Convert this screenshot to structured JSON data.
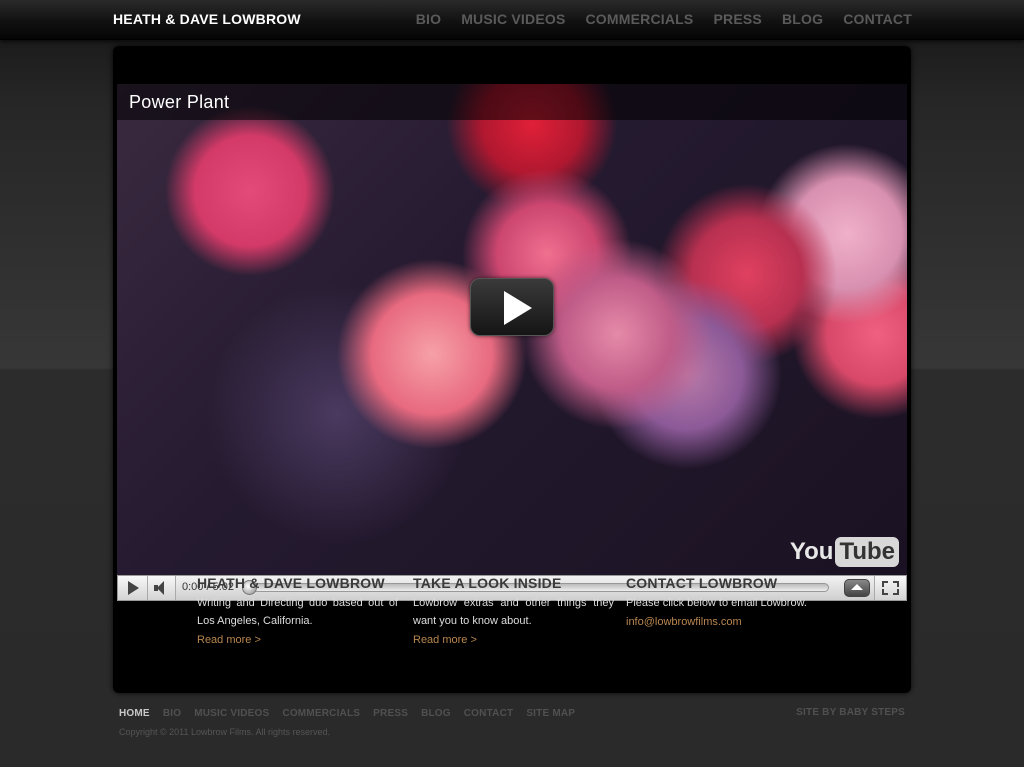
{
  "header": {
    "logo": "HEATH & DAVE LOWBROW",
    "nav": [
      "BIO",
      "MUSIC VIDEOS",
      "COMMERCIALS",
      "PRESS",
      "BLOG",
      "CONTACT"
    ]
  },
  "video": {
    "title": "Power Plant",
    "time": "0:00 / 5:02",
    "logo_you": "You",
    "logo_tube": "Tube",
    "progress": 0.0
  },
  "columns": [
    {
      "heading": "HEATH & DAVE LOWBROW",
      "text": "Writing and Directing duo based out of Los Angeles, California.",
      "link": "Read more >"
    },
    {
      "heading": "TAKE A LOOK INSIDE",
      "text": "Lowbrow extras and other things they want you to know about.",
      "link": "Read more >"
    },
    {
      "heading": "CONTACT LOWBROW",
      "text": "Please click below to email Lowbrow.",
      "link": "info@lowbrowfilms.com"
    }
  ],
  "footer": {
    "nav": [
      "HOME",
      "BIO",
      "MUSIC VIDEOS",
      "COMMERCIALS",
      "PRESS",
      "BLOG",
      "CONTACT",
      "SITE MAP"
    ],
    "site_by": "SITE BY BABY STEPS",
    "copyright": "Copyright © 2011 Lowbrow Films. All rights reserved."
  },
  "colors": {
    "link_accent": "#b8864f",
    "heading_muted": "#3a3a3a",
    "nav_muted": "#5a5a5a"
  },
  "icons": [
    "play-icon",
    "volume-icon",
    "fullscreen-icon",
    "expand-up-icon",
    "youtube-logo"
  ]
}
